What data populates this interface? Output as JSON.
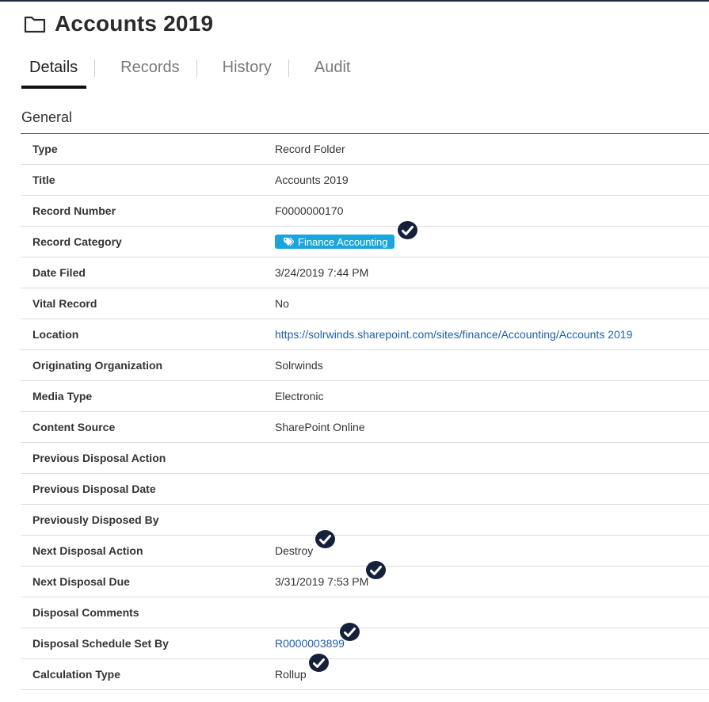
{
  "header": {
    "title": "Accounts 2019",
    "icon": "folder-icon"
  },
  "tabs": [
    {
      "label": "Details",
      "active": true
    },
    {
      "label": "Records",
      "active": false
    },
    {
      "label": "History",
      "active": false
    },
    {
      "label": "Audit",
      "active": false
    }
  ],
  "section": {
    "title": "General"
  },
  "fields": {
    "type": {
      "label": "Type",
      "value": "Record Folder"
    },
    "title": {
      "label": "Title",
      "value": "Accounts 2019"
    },
    "record_number": {
      "label": "Record Number",
      "value": "F0000000170"
    },
    "record_category": {
      "label": "Record Category",
      "value": "Finance Accounting"
    },
    "date_filed": {
      "label": "Date Filed",
      "value": "3/24/2019 7:44 PM"
    },
    "vital_record": {
      "label": "Vital Record",
      "value": "No"
    },
    "location": {
      "label": "Location",
      "value": "https://solrwinds.sharepoint.com/sites/finance/Accounting/Accounts 2019"
    },
    "originating_organization": {
      "label": "Originating Organization",
      "value": "Solrwinds"
    },
    "media_type": {
      "label": "Media Type",
      "value": "Electronic"
    },
    "content_source": {
      "label": "Content Source",
      "value": "SharePoint Online"
    },
    "previous_disposal_action": {
      "label": "Previous Disposal Action",
      "value": ""
    },
    "previous_disposal_date": {
      "label": "Previous Disposal Date",
      "value": ""
    },
    "previously_disposed_by": {
      "label": "Previously Disposed By",
      "value": ""
    },
    "next_disposal_action": {
      "label": "Next Disposal Action",
      "value": "Destroy"
    },
    "next_disposal_due": {
      "label": "Next Disposal Due",
      "value": "3/31/2019 7:53 PM"
    },
    "disposal_comments": {
      "label": "Disposal Comments",
      "value": ""
    },
    "disposal_schedule_set_by": {
      "label": "Disposal Schedule Set By",
      "value": "R0000003899"
    },
    "calculation_type": {
      "label": "Calculation Type",
      "value": "Rollup"
    }
  },
  "colors": {
    "tag_background": "#1aa6dc",
    "link": "#1f5fa8",
    "check_badge": "#15203a"
  }
}
